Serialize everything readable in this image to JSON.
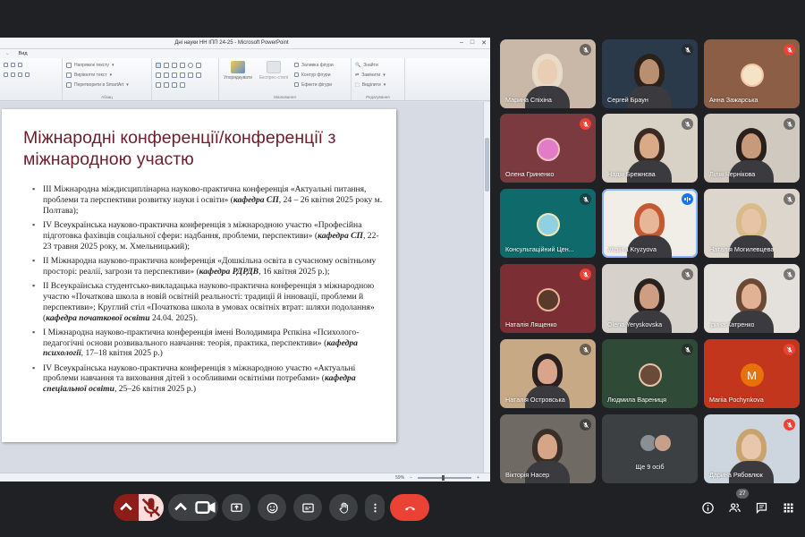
{
  "ppt": {
    "window_title": "Дні науки НН ІПП 24-25 - Microsoft PowerPoint",
    "tab_visible": "Вид",
    "ribbon": {
      "text_direction": "Напрямок тексту",
      "align_text": "Вирівняти текст",
      "convert_smartart": "Перетворити в SmartArt",
      "group_paragraph": "Абзац",
      "arrange": "Упорядкувати",
      "quick_styles": "Експрес-стилі",
      "shape_fill": "Заливка фігури",
      "shape_outline": "Контур фігури",
      "shape_effects": "Ефекти фігури",
      "group_drawing": "Малювання",
      "find": "Знайти",
      "replace": "Замінити",
      "select": "Виділити",
      "group_editing": "Редагування"
    },
    "zoom": "59%"
  },
  "slide": {
    "title": "Міжнародні конференції/конференції з міжнародною участю",
    "items": [
      {
        "text": "ІІІ Міжнародна міждисциплінарна науково-практична конференція «Актуальні питання, проблеми та перспективи розвитку науки і освіти» (",
        "dept": "кафедра СП",
        "tail": ", 24 – 26 квітня 2025 року м. Полтава);"
      },
      {
        "text": "IV Всеукраїнська науково-практична конференція з міжнародною участю «Професійна підготовка фахівців соціальної сфери: надбання, проблеми, перспективи» (",
        "dept": "кафедра СП",
        "tail": ", 22-23 травня 2025 року, м. Хмельницький);"
      },
      {
        "text": "ІІ Міжнародна науково-практична конференція «Дошкільна освіта в сучасному освітньому просторі: реалії, загрози та перспективи» (",
        "dept": "кафедра РДРДВ",
        "tail": ", 16 квітня 2025 р.);"
      },
      {
        "text": "ІІ Всеукраїнська студентсько-викладацька науково-практична конференція з міжнародною участю «Початкова школа в новій освітній реальності: традиції й інновації, проблеми й перспективи»; Круглий стіл «Початкова школа в умовах освітніх втрат: шляхи подолання» (",
        "dept": "кафедра початкової освіти",
        "tail": " 24.04. 2025)."
      },
      {
        "text": "І Міжнародна науково-практична конференція імені Володимира Рєпкіна «Психолого-педагогічні основи розвивального навчання: теорія, практика, перспективи» (",
        "dept": "кафедра психології",
        "tail": ", 17–18 квітня 2025 р.)"
      },
      {
        "text": "IV Всеукраїнська науково-практична конференція з міжнародною участю «Актуальні проблеми навчання та виховання дітей з особливими освітніми потребами» (",
        "dept": "кафедра спеціальної освіти",
        "tail": ", 25–26 квітня 2025 р.)"
      }
    ]
  },
  "participants": [
    {
      "name": "Марина Спіхіна",
      "mic": "muted"
    },
    {
      "name": "Сергей Браун",
      "mic": "muted"
    },
    {
      "name": "Анна Зажарська",
      "mic": "muted-red"
    },
    {
      "name": "Олена Гриненко",
      "mic": "muted-red"
    },
    {
      "name": "Надія Брежнєва",
      "mic": "muted"
    },
    {
      "name": "Лілія Чернікова",
      "mic": "muted"
    },
    {
      "name": "Консультаційний Цен...",
      "mic": "muted"
    },
    {
      "name": "Vitalina Kryzyova",
      "mic": "speaking"
    },
    {
      "name": "Наталія Могилевцева",
      "mic": "muted"
    },
    {
      "name": "Наталія Лященко",
      "mic": "muted-red"
    },
    {
      "name": "Olena Yeryskovska",
      "mic": "muted"
    },
    {
      "name": "Ірина Катренко",
      "mic": "muted"
    },
    {
      "name": "Наталія Островська",
      "mic": "muted"
    },
    {
      "name": "Людмила Варениця",
      "mic": "muted"
    },
    {
      "name": "Mariia Pochynkova",
      "mic": "muted-red",
      "initial": "M"
    },
    {
      "name": "Вікторія Насер",
      "mic": "muted"
    },
    {
      "name": "Ще 9 осіб",
      "mic": "none"
    },
    {
      "name": "Дарина Рябовлюк",
      "mic": "muted-red"
    }
  ],
  "toolbar": {
    "participant_count": "27"
  },
  "colors": {
    "slide_title": "#6b1f2a",
    "meet_bg": "#202124",
    "mic_off_red": "#ea4335",
    "end_call": "#ea4335",
    "speaking_blue": "#1a73e8",
    "avatar_orange": "#e8710a"
  }
}
